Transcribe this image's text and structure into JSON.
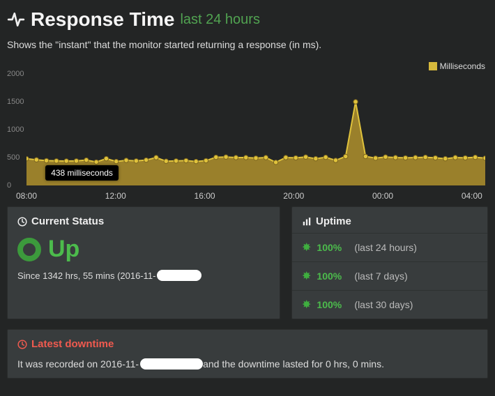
{
  "header": {
    "title": "Response Time",
    "subtitle": "last 24 hours"
  },
  "description": "Shows the \"instant\" that the monitor started returning a response (in ms).",
  "legend": {
    "label": "Milliseconds",
    "color": "#d6b93c"
  },
  "tooltip": {
    "text": "438 milliseconds"
  },
  "chart_data": {
    "type": "area",
    "xlabel": "",
    "ylabel": "",
    "ylim": [
      0,
      2000
    ],
    "y_ticks": [
      0,
      500,
      1000,
      1500,
      2000
    ],
    "categories": [
      "08:00",
      "12:00",
      "16:00",
      "20:00",
      "00:00",
      "04:00"
    ],
    "series": [
      {
        "name": "Milliseconds",
        "values": [
          480,
          460,
          445,
          440,
          438,
          440,
          455,
          420,
          480,
          430,
          450,
          440,
          455,
          500,
          435,
          440,
          445,
          430,
          445,
          505,
          510,
          500,
          500,
          490,
          500,
          415,
          500,
          495,
          510,
          480,
          505,
          450,
          520,
          1500,
          520,
          490,
          510,
          500,
          495,
          500,
          505,
          495,
          480,
          500,
          495,
          505,
          490
        ]
      }
    ],
    "tooltip_index": 4
  },
  "current_status": {
    "heading": "Current Status",
    "state": "Up",
    "since_prefix": "Since 1342 hrs, 55 mins (2016-11-",
    "since_suffix": ")"
  },
  "uptime": {
    "heading": "Uptime",
    "rows": [
      {
        "pct": "100%",
        "label": "(last 24 hours)"
      },
      {
        "pct": "100%",
        "label": "(last 7 days)"
      },
      {
        "pct": "100%",
        "label": "(last 30 days)"
      }
    ]
  },
  "downtime": {
    "heading": "Latest downtime",
    "pre": "It was recorded on 2016-11-",
    "post": "and the downtime lasted for 0 hrs, 0 mins."
  }
}
